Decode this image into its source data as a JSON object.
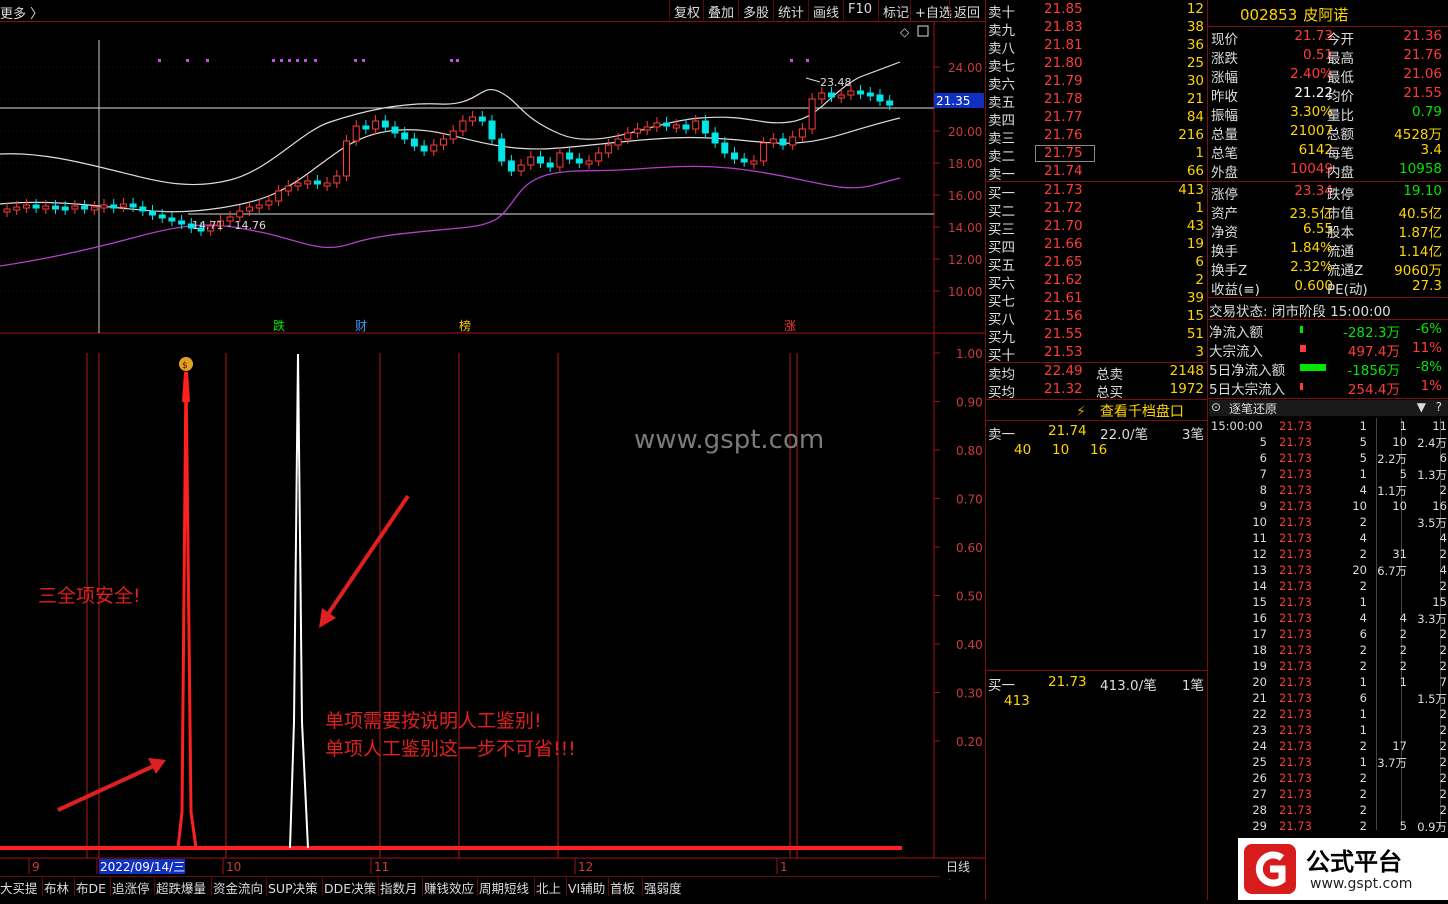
{
  "toolbar": {
    "more": "更多 〉",
    "buttons": [
      "复权",
      "叠加",
      "多股",
      "统计",
      "画线",
      "F10",
      "标记",
      "+自选",
      "返回"
    ]
  },
  "main_chart": {
    "y_ticks": [
      "24.00",
      "22.00",
      "20.00",
      "18.00",
      "16.00",
      "14.00",
      "12.00",
      "10.00"
    ],
    "price_flag": "21.35",
    "high_label": "23.48",
    "low_label": "14.71 - 14.76",
    "event_marks": [
      "跌",
      "财",
      "榜",
      "涨"
    ]
  },
  "indicator": {
    "y_ticks": [
      "1.00",
      "0.90",
      "0.80",
      "0.70",
      "0.60",
      "0.50",
      "0.40",
      "0.30",
      "0.20"
    ],
    "watermark": "www.gspt.com",
    "note1": "三全项安全!",
    "note2": "单项需要按说明人工鉴别!",
    "note3": "单项人工鉴别这一步不可省!!!",
    "values": [
      0,
      0,
      0,
      1,
      0,
      0,
      0.93,
      0,
      0,
      0,
      0,
      0,
      0
    ]
  },
  "x_axis": {
    "labels": [
      "9",
      "2022/09/14/三",
      "10",
      "11",
      "12",
      "1"
    ],
    "period": "日线",
    "plus": "+",
    "minus": "−"
  },
  "bottom_tabs": [
    "大买提",
    "布林",
    "布DE",
    "追涨停",
    "超跌爆量",
    "资金流向",
    "SUP决策",
    "DDE决策",
    "指数月",
    "赚钱效应",
    "周期短线",
    "北上",
    "VI辅助",
    "首板",
    "强弱度"
  ],
  "order_book": {
    "asks": [
      [
        "卖十",
        "21.85",
        "12"
      ],
      [
        "卖九",
        "21.83",
        "38"
      ],
      [
        "卖八",
        "21.81",
        "36"
      ],
      [
        "卖七",
        "21.80",
        "25"
      ],
      [
        "卖六",
        "21.79",
        "30"
      ],
      [
        "卖五",
        "21.78",
        "21"
      ],
      [
        "卖四",
        "21.77",
        "84"
      ],
      [
        "卖三",
        "21.76",
        "216"
      ],
      [
        "卖二",
        "21.75",
        "1"
      ],
      [
        "卖一",
        "21.74",
        "66"
      ]
    ],
    "bids": [
      [
        "买一",
        "21.73",
        "413"
      ],
      [
        "买二",
        "21.72",
        "1"
      ],
      [
        "买三",
        "21.70",
        "43"
      ],
      [
        "买四",
        "21.66",
        "19"
      ],
      [
        "买五",
        "21.65",
        "6"
      ],
      [
        "买六",
        "21.62",
        "2"
      ],
      [
        "买七",
        "21.61",
        "39"
      ],
      [
        "买八",
        "21.56",
        "15"
      ],
      [
        "买九",
        "21.55",
        "51"
      ],
      [
        "买十",
        "21.53",
        "3"
      ]
    ],
    "avg_sell": {
      "label": "卖均",
      "price": "22.49",
      "total_label": "总卖",
      "total": "2148"
    },
    "avg_buy": {
      "label": "买均",
      "price": "21.32",
      "total_label": "总买",
      "total": "1972"
    },
    "ten_level": "查看千档盘口",
    "ask1_detail": {
      "label": "卖一",
      "price": "21.74",
      "per": "22.0/笔",
      "count": "3笔",
      "orders": [
        "40",
        "10",
        "16"
      ]
    },
    "bid1_detail": {
      "label": "买一",
      "price": "21.73",
      "per": "413.0/笔",
      "count": "1笔",
      "orders": [
        "413"
      ]
    }
  },
  "quote": {
    "code": "002853",
    "name": "皮阿诺",
    "rows": [
      [
        "现价",
        "21.73",
        "今开",
        "21.36"
      ],
      [
        "涨跌",
        "0.51",
        "最高",
        "21.76"
      ],
      [
        "涨幅",
        "2.40%",
        "最低",
        "21.06"
      ],
      [
        "昨收",
        "21.22",
        "均价",
        "21.55"
      ],
      [
        "振幅",
        "3.30%",
        "量比",
        "0.79"
      ],
      [
        "总量",
        "21007",
        "总额",
        "4528万"
      ],
      [
        "总笔",
        "6142",
        "每笔",
        "3.4"
      ],
      [
        "外盘",
        "10049",
        "内盘",
        "10958"
      ]
    ],
    "rows2": [
      [
        "涨停",
        "23.34",
        "跌停",
        "19.10"
      ],
      [
        "资产",
        "23.5亿",
        "市值",
        "40.5亿"
      ],
      [
        "净资",
        "6.55",
        "股本",
        "1.87亿"
      ],
      [
        "换手",
        "1.84%",
        "流通",
        "1.14亿"
      ],
      [
        "换手Z",
        "2.32%",
        "流通Z",
        "9060万"
      ],
      [
        "收益(≡)",
        "0.600",
        "PE(动)",
        "27.3"
      ]
    ],
    "status": "交易状态: 闭市阶段 15:00:00",
    "flows": [
      [
        "净流入额",
        "-282.3万",
        "-6%"
      ],
      [
        "大宗流入",
        "497.4万",
        "11%"
      ],
      [
        "5日净流入额",
        "-1856万",
        "-8%"
      ],
      [
        "5日大宗流入",
        "254.4万",
        "1%"
      ]
    ]
  },
  "ticks": {
    "title": "逐笔还原",
    "rows": [
      [
        "15:00:00",
        "21.73",
        "1",
        "1",
        "11"
      ],
      [
        "5",
        "21.73",
        "5",
        "10",
        "2.4万"
      ],
      [
        "6",
        "21.73",
        "5",
        "2.2万",
        "6"
      ],
      [
        "7",
        "21.73",
        "1",
        "5",
        "1.3万"
      ],
      [
        "8",
        "21.73",
        "4",
        "1.1万",
        "2"
      ],
      [
        "9",
        "21.73",
        "10",
        "10",
        "16"
      ],
      [
        "10",
        "21.73",
        "2",
        "",
        "3.5万"
      ],
      [
        "11",
        "21.73",
        "4",
        "",
        "4"
      ],
      [
        "12",
        "21.73",
        "2",
        "31",
        "2"
      ],
      [
        "13",
        "21.73",
        "20",
        "6.7万",
        "4"
      ],
      [
        "14",
        "21.73",
        "2",
        "",
        "2"
      ],
      [
        "15",
        "21.73",
        "1",
        "",
        "15"
      ],
      [
        "16",
        "21.73",
        "4",
        "4",
        "3.3万"
      ],
      [
        "17",
        "21.73",
        "6",
        "2",
        "2"
      ],
      [
        "18",
        "21.73",
        "2",
        "2",
        "2"
      ],
      [
        "19",
        "21.73",
        "2",
        "2",
        "2"
      ],
      [
        "20",
        "21.73",
        "1",
        "1",
        "7"
      ],
      [
        "21",
        "21.73",
        "6",
        "",
        "1.5万"
      ],
      [
        "22",
        "21.73",
        "1",
        "",
        "2"
      ],
      [
        "23",
        "21.73",
        "1",
        "",
        "2"
      ],
      [
        "24",
        "21.73",
        "2",
        "17",
        "2"
      ],
      [
        "25",
        "21.73",
        "1",
        "3.7万",
        "2"
      ],
      [
        "26",
        "21.73",
        "2",
        "",
        "2"
      ],
      [
        "27",
        "21.73",
        "2",
        "",
        "2"
      ],
      [
        "28",
        "21.73",
        "2",
        "",
        "2"
      ],
      [
        "29",
        "21.73",
        "2",
        "5",
        "0.9万"
      ]
    ]
  },
  "logo": {
    "text": "公式平台",
    "url": "www.gspt.com"
  },
  "colors": {
    "up": "#ff3b3b",
    "down": "#00e6e6",
    "ma": "#ffffff",
    "bollLow": "#b040c8",
    "red": "#ff2020"
  }
}
